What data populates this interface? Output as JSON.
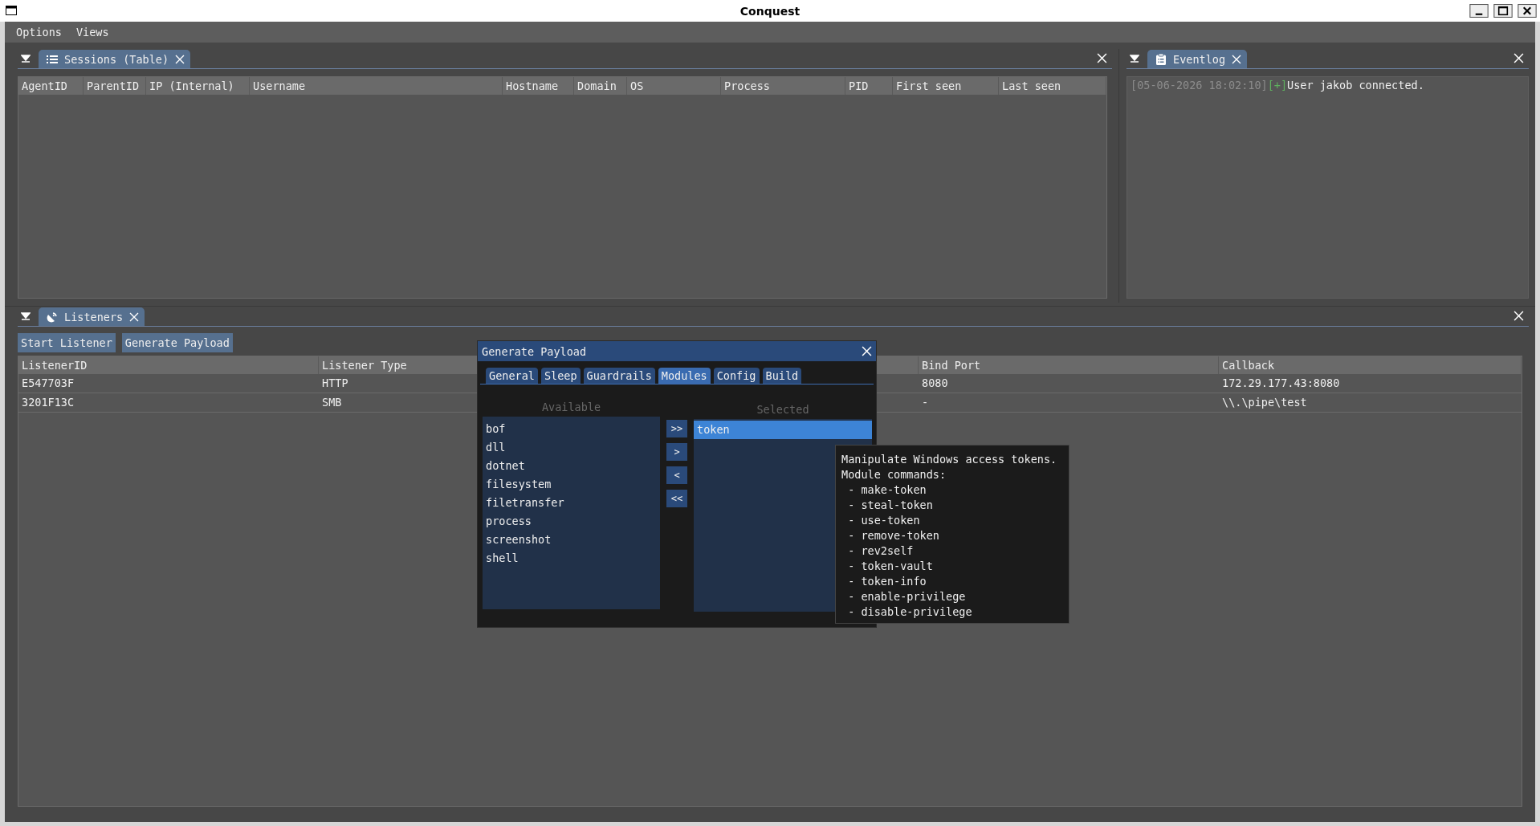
{
  "window": {
    "title": "Conquest"
  },
  "menu": [
    "Options",
    "Views"
  ],
  "sessions_dock": {
    "tab": "Sessions (Table)",
    "columns": [
      "AgentID",
      "ParentID",
      "IP (Internal)",
      "Username",
      "Hostname",
      "Domain",
      "OS",
      "Process",
      "PID",
      "First seen",
      "Last seen"
    ]
  },
  "eventlog_dock": {
    "tab": "Eventlog",
    "entries": [
      {
        "time": "[05-06-2026 18:02:10]",
        "tag": "[+]",
        "message": "User jakob connected."
      }
    ]
  },
  "listeners_dock": {
    "tab": "Listeners",
    "buttons": [
      "Start Listener",
      "Generate Payload"
    ],
    "columns": [
      "ListenerID",
      "Listener Type",
      "Bind Port",
      "Callback"
    ],
    "rows": [
      [
        "E547703F",
        "HTTP",
        "8080",
        "172.29.177.43:8080"
      ],
      [
        "3201F13C",
        "SMB",
        "-",
        "\\\\.\\pipe\\test"
      ]
    ]
  },
  "dialog": {
    "title": "Generate Payload",
    "tabs": [
      {
        "label": "General",
        "selected": false
      },
      {
        "label": "Sleep",
        "selected": false
      },
      {
        "label": "Guardrails",
        "selected": false
      },
      {
        "label": "Modules",
        "selected": true
      },
      {
        "label": "Config",
        "selected": false
      },
      {
        "label": "Build",
        "selected": false
      }
    ],
    "available_label": "Available",
    "available": [
      "bof",
      "dll",
      "dotnet",
      "filesystem",
      "filetransfer",
      "process",
      "screenshot",
      "shell"
    ],
    "move_buttons": [
      ">>",
      ">",
      "<",
      "<<"
    ],
    "selected_label": "Selected",
    "selected_modules": [
      {
        "label": "token",
        "selected": true
      }
    ]
  },
  "tooltip": {
    "lines": [
      "Manipulate Windows access tokens.",
      "Module commands:",
      " - make-token",
      " - steal-token",
      " - use-token",
      " - remove-token",
      " - rev2self",
      " - token-vault",
      " - token-info",
      " - enable-privilege",
      " - disable-privilege"
    ]
  }
}
